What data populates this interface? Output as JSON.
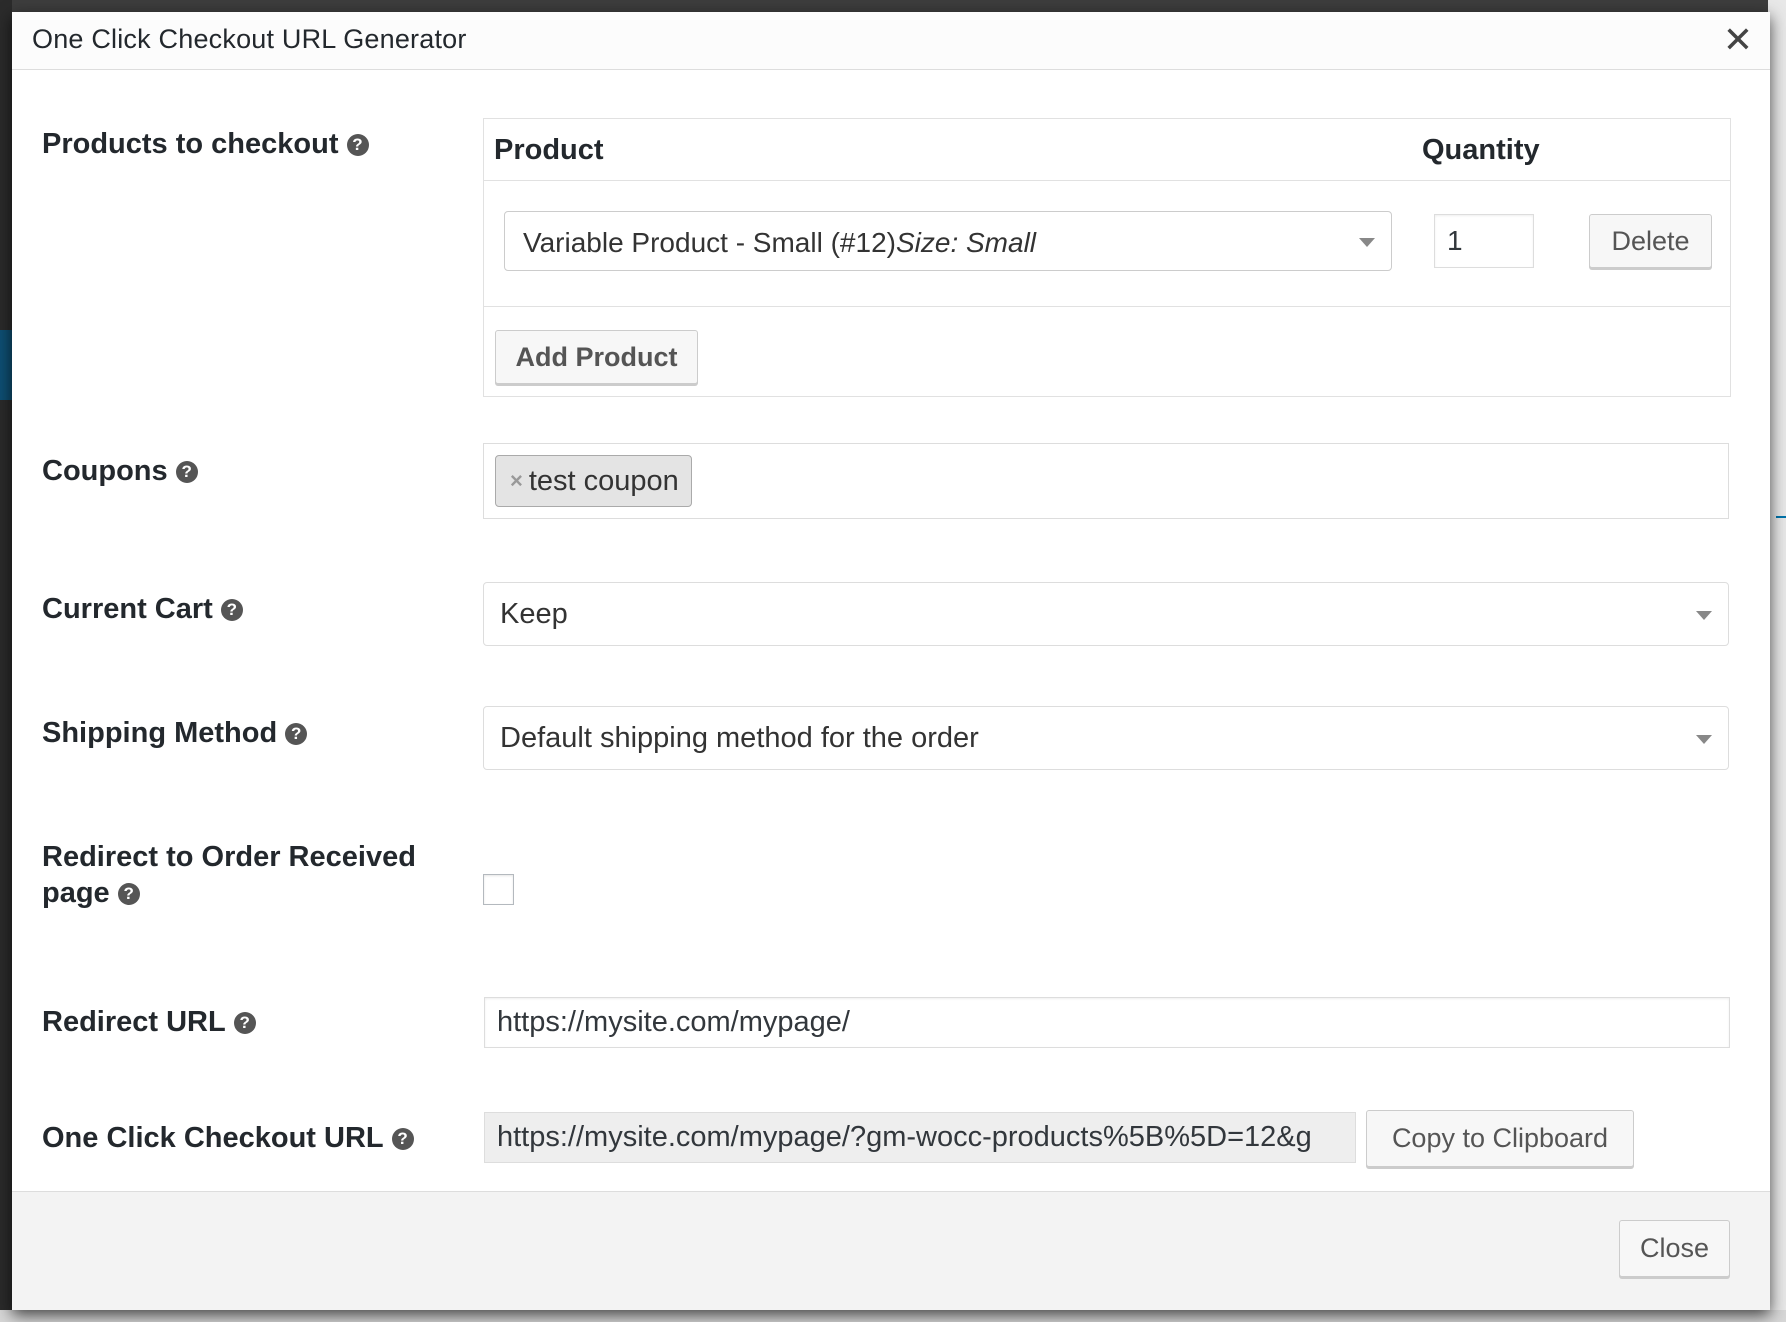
{
  "modal": {
    "title": "One Click Checkout URL Generator",
    "close_icon": "close-icon",
    "footer_close_label": "Close"
  },
  "products": {
    "label": "Products to checkout",
    "col_product": "Product",
    "col_quantity": "Quantity",
    "rows": [
      {
        "product_name": "Variable Product - Small (#12)",
        "variation": "Size: Small",
        "quantity": "1",
        "delete_label": "Delete"
      }
    ],
    "add_label": "Add Product"
  },
  "coupons": {
    "label": "Coupons",
    "items": [
      "test coupon"
    ],
    "remove_glyph": "×"
  },
  "current_cart": {
    "label": "Current Cart",
    "selected": "Keep"
  },
  "shipping": {
    "label": "Shipping Method",
    "selected": "Default shipping method for the order"
  },
  "redirect_order_received": {
    "label_line1": "Redirect to Order Received",
    "label_line2": "page",
    "checked": false
  },
  "redirect_url": {
    "label": "Redirect URL",
    "value": "https://mysite.com/mypage/"
  },
  "checkout_url": {
    "label": "One Click Checkout URL",
    "value": "https://mysite.com/mypage/?gm-wocc-products%5B%5D=12&g",
    "copy_label": "Copy to Clipboard"
  },
  "help_glyph": "?",
  "colors": {
    "help_icon": "#555555",
    "footer_bg": "#f3f3f3",
    "chip_bg": "#e4e4e4"
  }
}
